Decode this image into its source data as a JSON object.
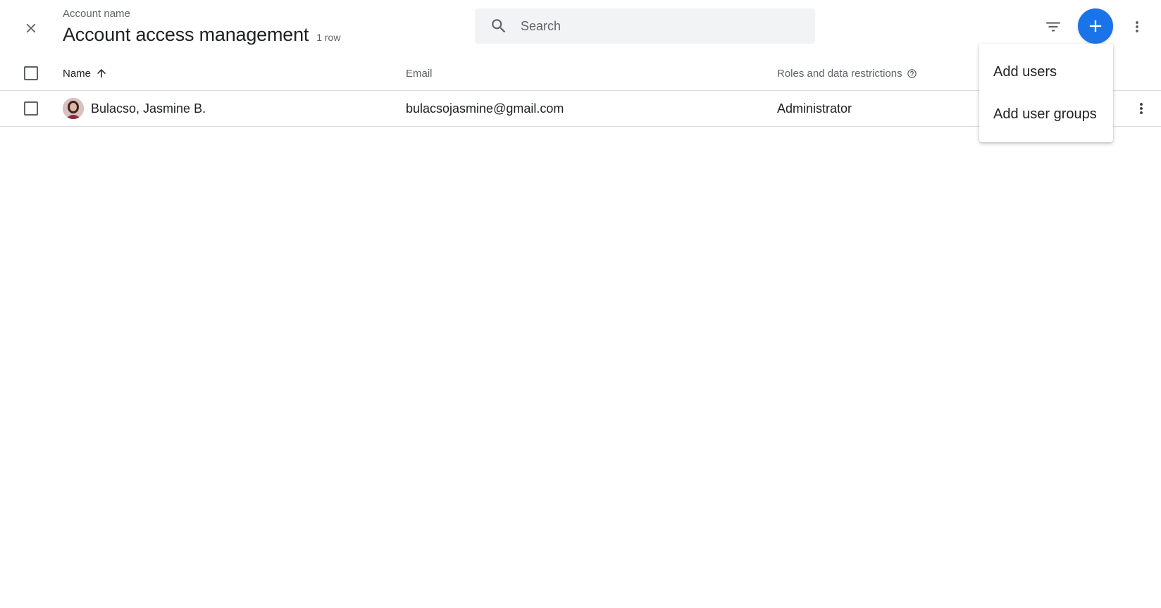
{
  "header": {
    "account_label": "Account name",
    "title": "Account access management",
    "row_count": "1 row"
  },
  "search": {
    "placeholder": "Search",
    "value": ""
  },
  "table": {
    "columns": {
      "name": "Name",
      "email": "Email",
      "roles": "Roles and data restrictions"
    },
    "rows": [
      {
        "name": "Bulacso, Jasmine B.",
        "email": "bulacsojasmine@gmail.com",
        "role": "Administrator"
      }
    ]
  },
  "add_menu": {
    "items": [
      {
        "label": "Add users"
      },
      {
        "label": "Add user groups"
      }
    ]
  },
  "icons": {
    "close": "close-icon",
    "search": "search-icon",
    "filter": "filter-icon",
    "add": "plus-icon",
    "more": "more-vert-icon",
    "sort": "arrow-up-icon",
    "help": "help-circle-icon"
  },
  "colors": {
    "accent": "#1a73e8",
    "search_bg": "#f1f3f4",
    "divider": "#dadce0",
    "secondary_text": "#5f6368"
  }
}
